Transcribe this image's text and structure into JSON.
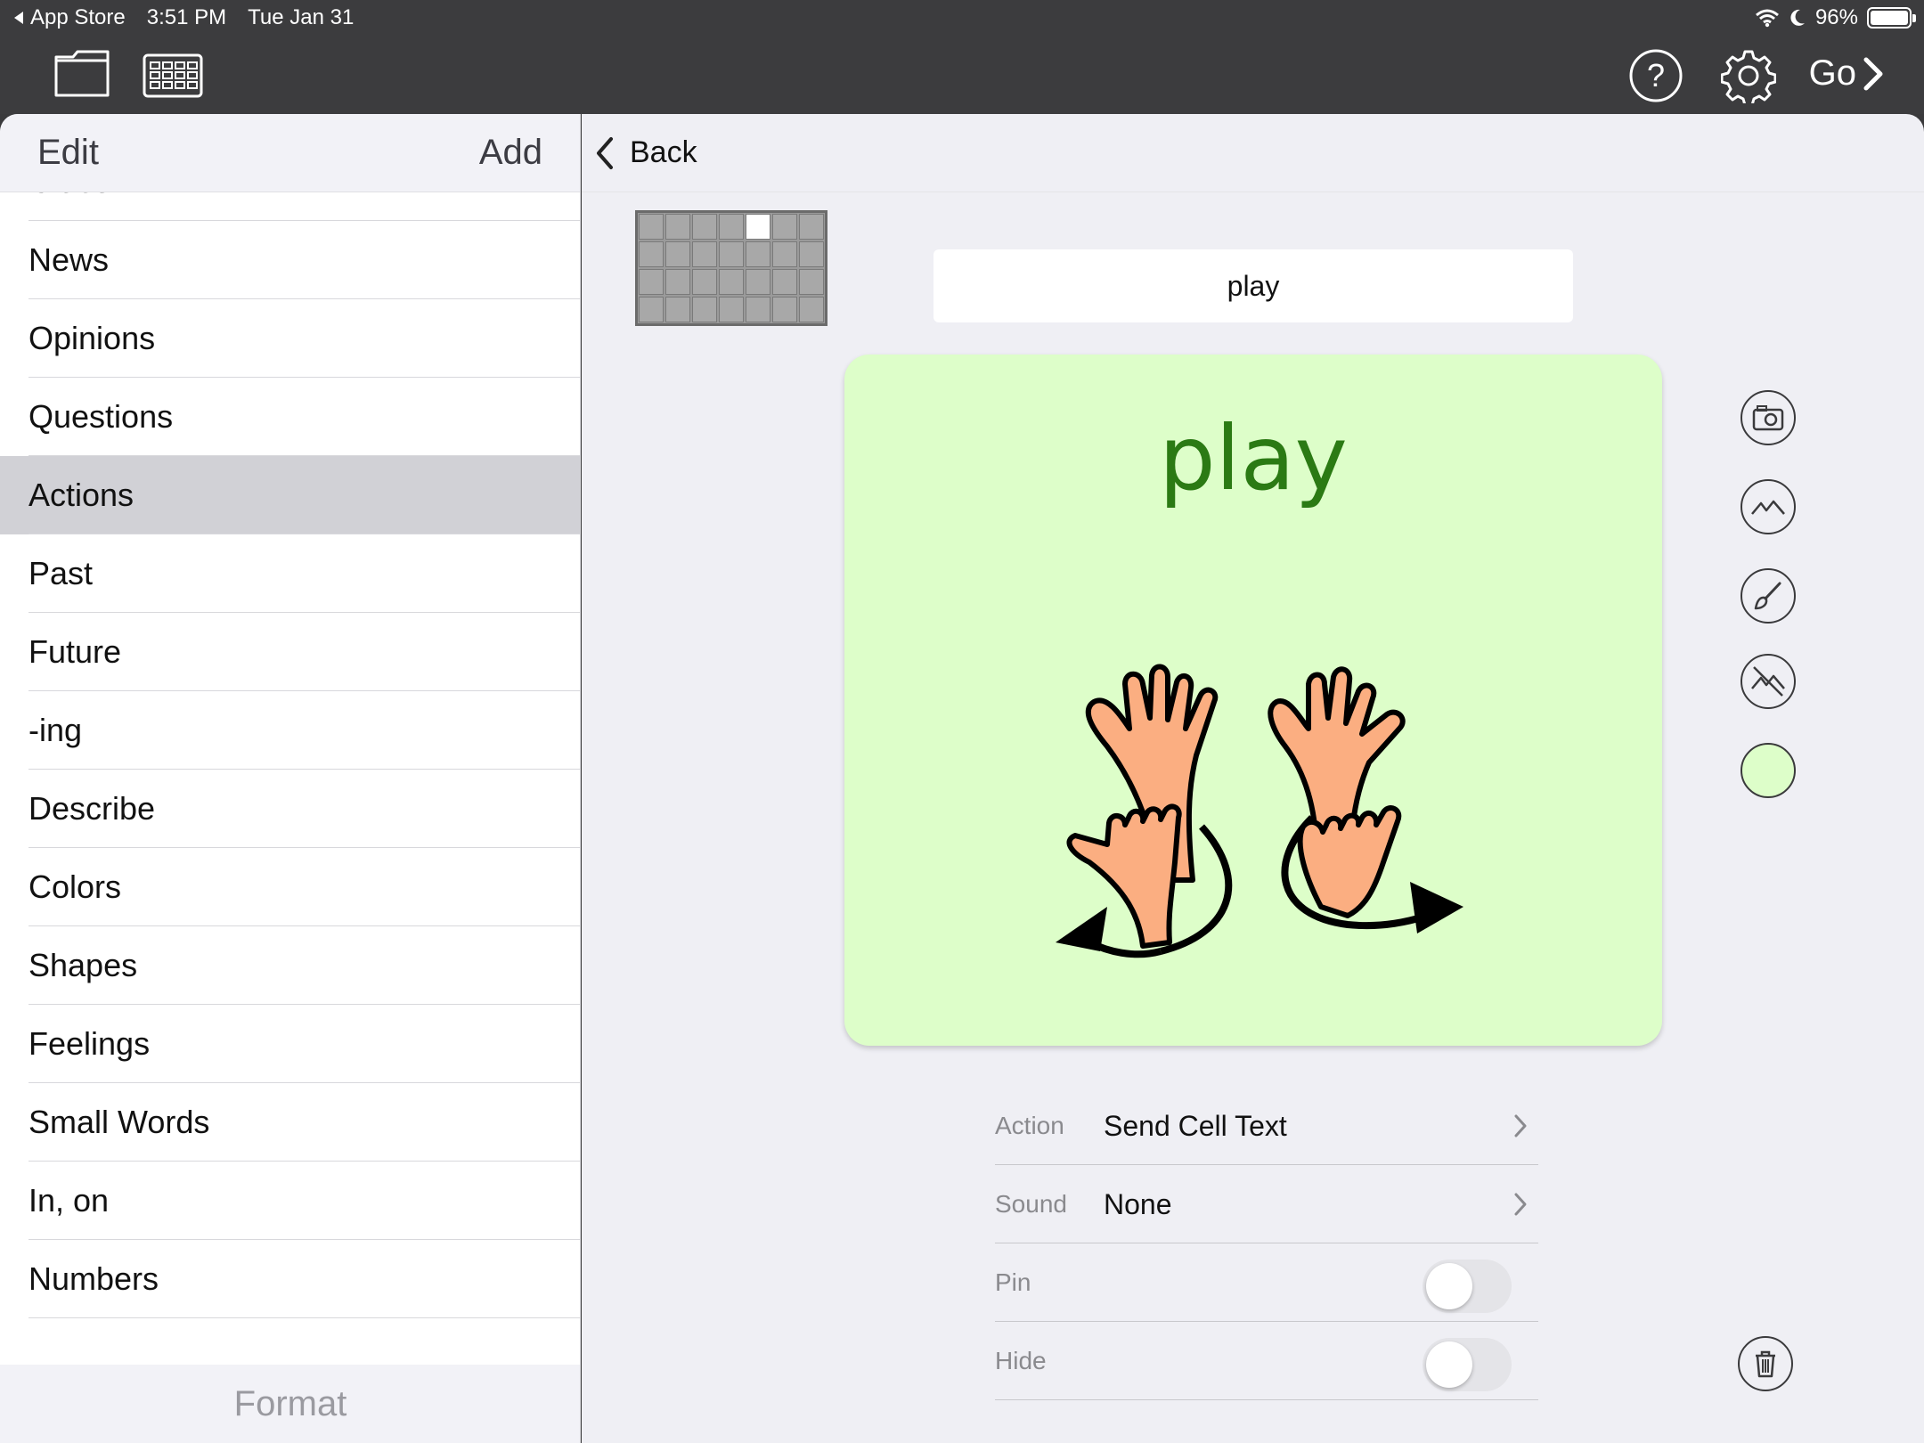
{
  "status_bar": {
    "back_app": "App Store",
    "time": "3:51 PM",
    "date": "Tue Jan 31",
    "battery": "96%"
  },
  "toolbar": {
    "go_label": "Go",
    "icons": [
      "folder-icon",
      "grid-keyboard-icon",
      "help-icon",
      "gear-icon",
      "chevron-right-icon"
    ]
  },
  "sidebar": {
    "edit_label": "Edit",
    "add_label": "Add",
    "footer_label": "Format",
    "selected": "Actions",
    "items": [
      {
        "label": "Clues"
      },
      {
        "label": "News"
      },
      {
        "label": "Opinions"
      },
      {
        "label": "Questions"
      },
      {
        "label": "Actions"
      },
      {
        "label": "Past"
      },
      {
        "label": "Future"
      },
      {
        "label": "-ing"
      },
      {
        "label": "Describe"
      },
      {
        "label": "Colors"
      },
      {
        "label": "Shapes"
      },
      {
        "label": "Feelings"
      },
      {
        "label": "Small Words"
      },
      {
        "label": "In, on"
      },
      {
        "label": "Numbers"
      },
      {
        "label": ". . ."
      }
    ]
  },
  "main": {
    "back_label": "Back",
    "cell_text_field": "play",
    "cell": {
      "word": "play",
      "background_color": "#ddfec9",
      "text_color": "#2b7a14",
      "symbol": "play-hands-symbol"
    },
    "tools": [
      "camera-icon",
      "image-library-icon",
      "brush-icon",
      "remove-image-icon",
      "color-swatch"
    ],
    "properties": {
      "action_label": "Action",
      "action_value": "Send Cell Text",
      "sound_label": "Sound",
      "sound_value": "None",
      "pin_label": "Pin",
      "pin_on": false,
      "hide_label": "Hide",
      "hide_on": false
    }
  }
}
